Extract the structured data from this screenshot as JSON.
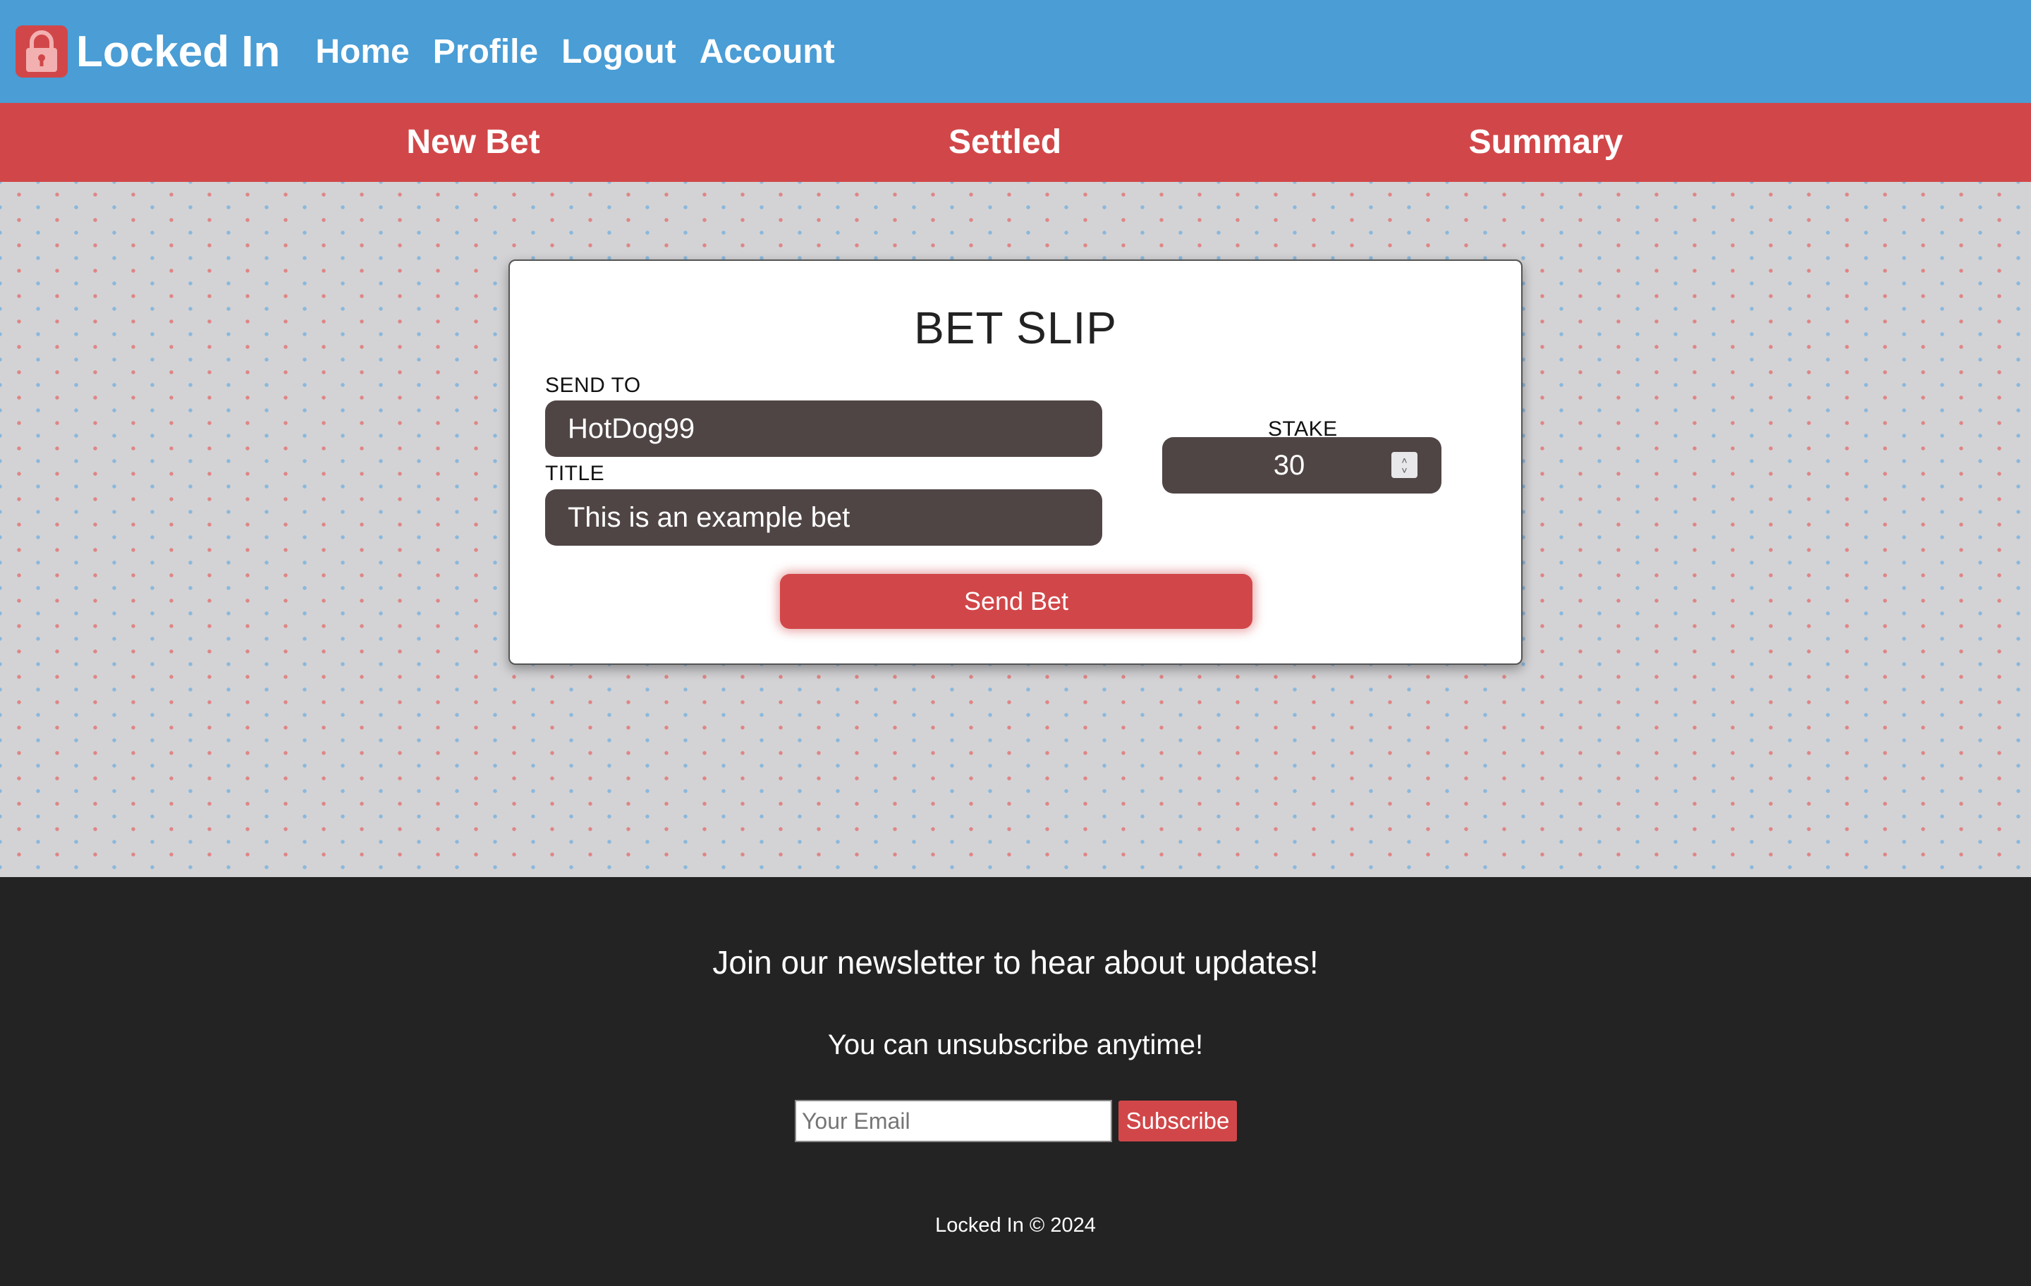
{
  "header": {
    "brand": "Locked In",
    "logo_icon": "padlock-icon",
    "nav": [
      "Home",
      "Profile",
      "Logout",
      "Account"
    ]
  },
  "subnav": {
    "items": [
      "New Bet",
      "Settled",
      "Summary"
    ]
  },
  "bet_slip": {
    "title": "BET SLIP",
    "send_to_label": "SEND TO",
    "send_to_value": "HotDog99",
    "title_label": "TITLE",
    "title_value": "This is an example bet",
    "stake_label": "STAKE",
    "stake_value": "30",
    "send_button": "Send Bet"
  },
  "footer": {
    "heading": "Join our newsletter to hear about updates!",
    "subheading": "You can unsubscribe anytime!",
    "email_placeholder": "Your Email",
    "subscribe_button": "Subscribe",
    "copyright": "Locked In © 2024"
  },
  "colors": {
    "header_bg": "#4a9dd5",
    "accent_red": "#d14749",
    "field_bg": "#504545",
    "footer_bg": "#232323"
  }
}
